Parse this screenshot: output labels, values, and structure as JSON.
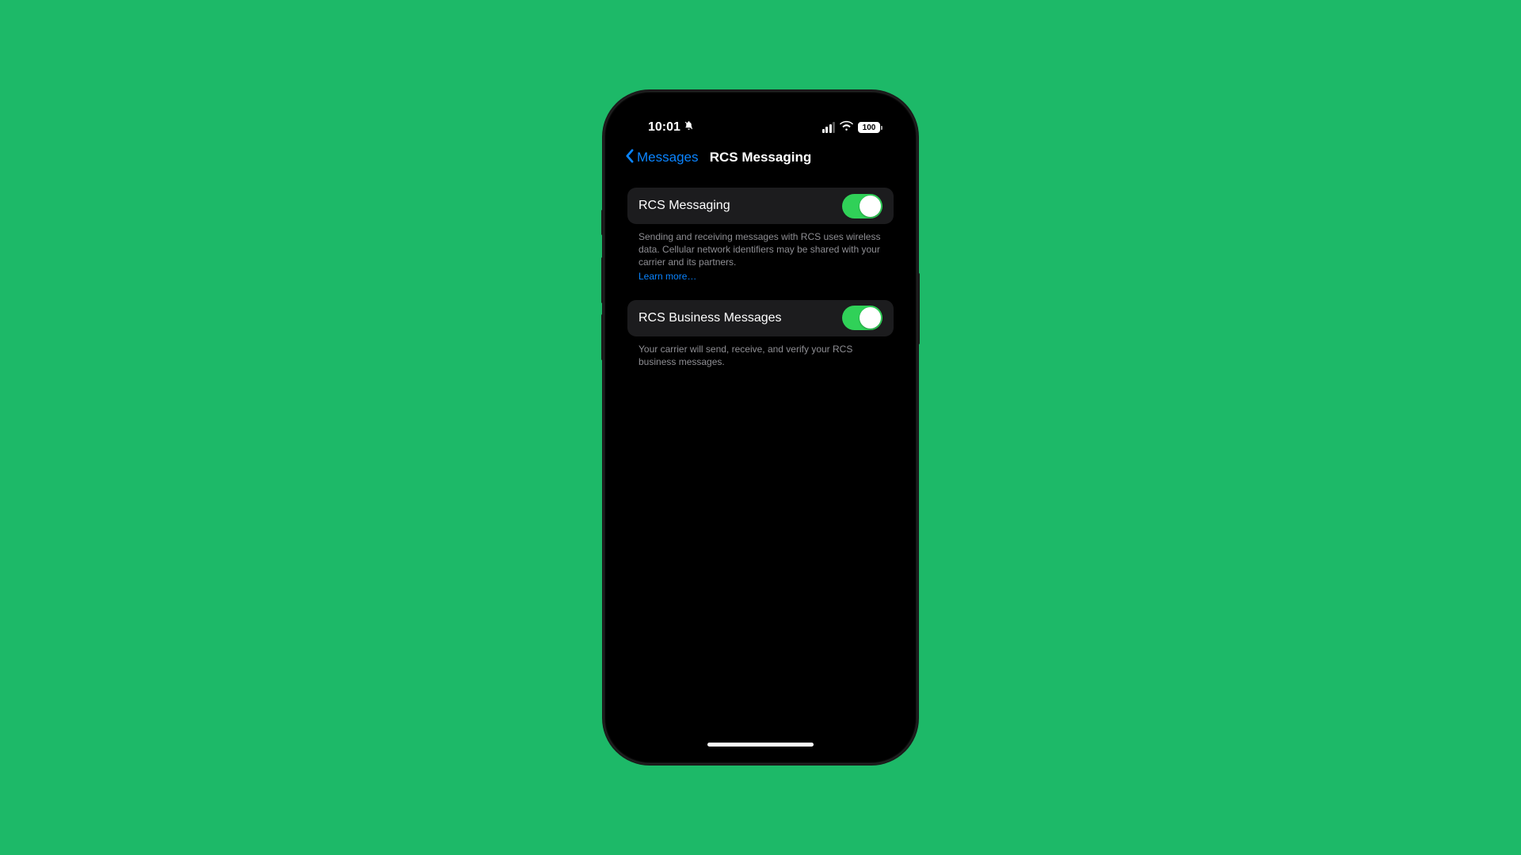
{
  "status": {
    "time": "10:01",
    "battery": "100"
  },
  "nav": {
    "back_label": "Messages",
    "title": "RCS Messaging"
  },
  "settings": {
    "rcs_messaging": {
      "label": "RCS Messaging",
      "enabled": true,
      "footer": "Sending and receiving messages with RCS uses wireless data. Cellular network identifiers may be shared with your carrier and its partners.",
      "learn_more": "Learn more…"
    },
    "rcs_business": {
      "label": "RCS Business Messages",
      "enabled": true,
      "footer": "Your carrier will send, receive, and verify your RCS business messages."
    }
  }
}
